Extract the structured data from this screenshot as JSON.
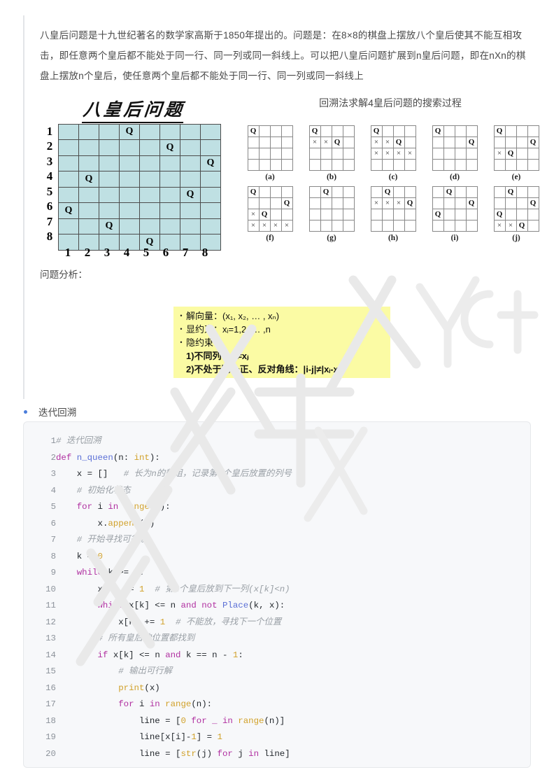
{
  "document": {
    "intro_paragraph": "八皇后问题是十九世纪著名的数学家高斯于1850年提出的。问题是：在8×8的棋盘上摆放八个皇后使其不能互相攻击，即任意两个皇后都不能处于同一行、同一列或同一斜线上。可以把八皇后问题扩展到n皇后问题，即在nXn的棋盘上摆放n个皇后，使任意两个皇后都不能处于同一行、同一列或同一斜线上",
    "analysis_label": "问题分析："
  },
  "board8": {
    "title": "八皇后问题",
    "cell_color": "#bfe0e3",
    "queen_glyph": "Q",
    "row_labels": [
      "1",
      "2",
      "3",
      "4",
      "5",
      "6",
      "7",
      "8"
    ],
    "col_labels": [
      "1",
      "2",
      "3",
      "4",
      "5",
      "6",
      "7",
      "8"
    ],
    "queen_columns": [
      4,
      6,
      8,
      2,
      7,
      1,
      3,
      5
    ]
  },
  "search_process": {
    "title": "回溯法求解4皇后问题的搜索过程",
    "queen_glyph": "Q",
    "cross_glyph": "×",
    "diagrams": [
      {
        "label": "(a)",
        "cells": [
          [
            "Q",
            "",
            "",
            " "
          ],
          [
            "",
            "",
            "",
            ""
          ],
          [
            "",
            "",
            "",
            ""
          ],
          [
            "",
            "",
            "",
            ""
          ]
        ]
      },
      {
        "label": "(b)",
        "cells": [
          [
            "Q",
            "",
            "",
            ""
          ],
          [
            "×",
            "×",
            "Q",
            ""
          ],
          [
            "",
            "",
            "",
            ""
          ],
          [
            "",
            "",
            "",
            ""
          ]
        ]
      },
      {
        "label": "(c)",
        "cells": [
          [
            "Q",
            "",
            "",
            ""
          ],
          [
            "×",
            "×",
            "Q",
            ""
          ],
          [
            "×",
            "×",
            "×",
            "×"
          ],
          [
            "",
            "",
            "",
            ""
          ]
        ]
      },
      {
        "label": "(d)",
        "cells": [
          [
            "Q",
            "",
            "",
            ""
          ],
          [
            "",
            "",
            "",
            "Q"
          ],
          [
            "",
            "",
            "",
            ""
          ],
          [
            "",
            "",
            "",
            ""
          ]
        ]
      },
      {
        "label": "(e)",
        "cells": [
          [
            "Q",
            "",
            "",
            ""
          ],
          [
            "",
            "",
            "",
            "Q"
          ],
          [
            "×",
            "Q",
            "",
            ""
          ],
          [
            "",
            "",
            "",
            ""
          ]
        ]
      },
      {
        "label": "(f)",
        "cells": [
          [
            "Q",
            "",
            "",
            ""
          ],
          [
            "",
            "",
            "",
            "Q"
          ],
          [
            "×",
            "Q",
            "",
            ""
          ],
          [
            "×",
            "×",
            "×",
            "×"
          ]
        ]
      },
      {
        "label": "(g)",
        "cells": [
          [
            "",
            "Q",
            "",
            ""
          ],
          [
            "",
            "",
            "",
            ""
          ],
          [
            "",
            "",
            "",
            ""
          ],
          [
            "",
            "",
            "",
            ""
          ]
        ]
      },
      {
        "label": "(h)",
        "cells": [
          [
            "",
            "Q",
            "",
            ""
          ],
          [
            "×",
            "×",
            "×",
            "Q"
          ],
          [
            "",
            "",
            "",
            ""
          ],
          [
            "",
            "",
            "",
            ""
          ]
        ]
      },
      {
        "label": "(i)",
        "cells": [
          [
            "",
            "Q",
            "",
            ""
          ],
          [
            "",
            "",
            "",
            "Q"
          ],
          [
            "Q",
            "",
            "",
            ""
          ],
          [
            "",
            "",
            "",
            ""
          ]
        ]
      },
      {
        "label": "(j)",
        "cells": [
          [
            "",
            "Q",
            "",
            ""
          ],
          [
            "",
            "",
            "",
            "Q"
          ],
          [
            "Q",
            "",
            "",
            ""
          ],
          [
            "×",
            "×",
            "Q",
            ""
          ]
        ]
      }
    ]
  },
  "yellow_note": {
    "background": "#fbfba4",
    "lines": [
      {
        "bullet": true,
        "text": "解向量：(x₁, x₂, … , xₙ)"
      },
      {
        "bullet": true,
        "text": "显约束：xᵢ=1,2, … ,n"
      },
      {
        "bullet": true,
        "text": "隐约束："
      },
      {
        "bullet": false,
        "text": "1)不同列：xᵢ≠xⱼ"
      },
      {
        "bullet": false,
        "text": "2)不处于同一正、反对角线：|i-j|≠|xᵢ-xⱼ|"
      }
    ]
  },
  "section_bullet": {
    "label": "迭代回溯",
    "dot_color": "#4a7ddb"
  },
  "code_block": {
    "background": "#f7f8fa",
    "language": "python",
    "lines": [
      {
        "n": "1",
        "text": "# 迭代回溯"
      },
      {
        "n": "2",
        "text": "def n_queen(n: int):"
      },
      {
        "n": "3",
        "text": "    x = []   # 长为n的数组，记录第k个皇后放置的列号"
      },
      {
        "n": "4",
        "text": "    # 初始化状态"
      },
      {
        "n": "5",
        "text": "    for i in range(n):"
      },
      {
        "n": "6",
        "text": "        x.append(0)"
      },
      {
        "n": "7",
        "text": "    # 开始寻找可行解"
      },
      {
        "n": "8",
        "text": "    k = 0"
      },
      {
        "n": "9",
        "text": "    while k >= 0:"
      },
      {
        "n": "10",
        "text": "        x[k] += 1  # 第k个皇后放到下一列(x[k]<n)"
      },
      {
        "n": "11",
        "text": "        while x[k] <= n and not Place(k, x):"
      },
      {
        "n": "12",
        "text": "            x[k] += 1  # 不能放，寻找下一个位置"
      },
      {
        "n": "13",
        "text": "        # 所有皇后的位置都找到"
      },
      {
        "n": "14",
        "text": "        if x[k] <= n and k == n - 1:"
      },
      {
        "n": "15",
        "text": "            # 输出可行解"
      },
      {
        "n": "16",
        "text": "            print(x)"
      },
      {
        "n": "17",
        "text": "            for i in range(n):"
      },
      {
        "n": "18",
        "text": "                line = [0 for _ in range(n)]"
      },
      {
        "n": "19",
        "text": "                line[x[i]-1] = 1"
      },
      {
        "n": "20",
        "text": "                line = [str(j) for j in line]"
      }
    ]
  },
  "watermark": {
    "text": "技诺清风cyf",
    "color": "#e8e8e8"
  }
}
